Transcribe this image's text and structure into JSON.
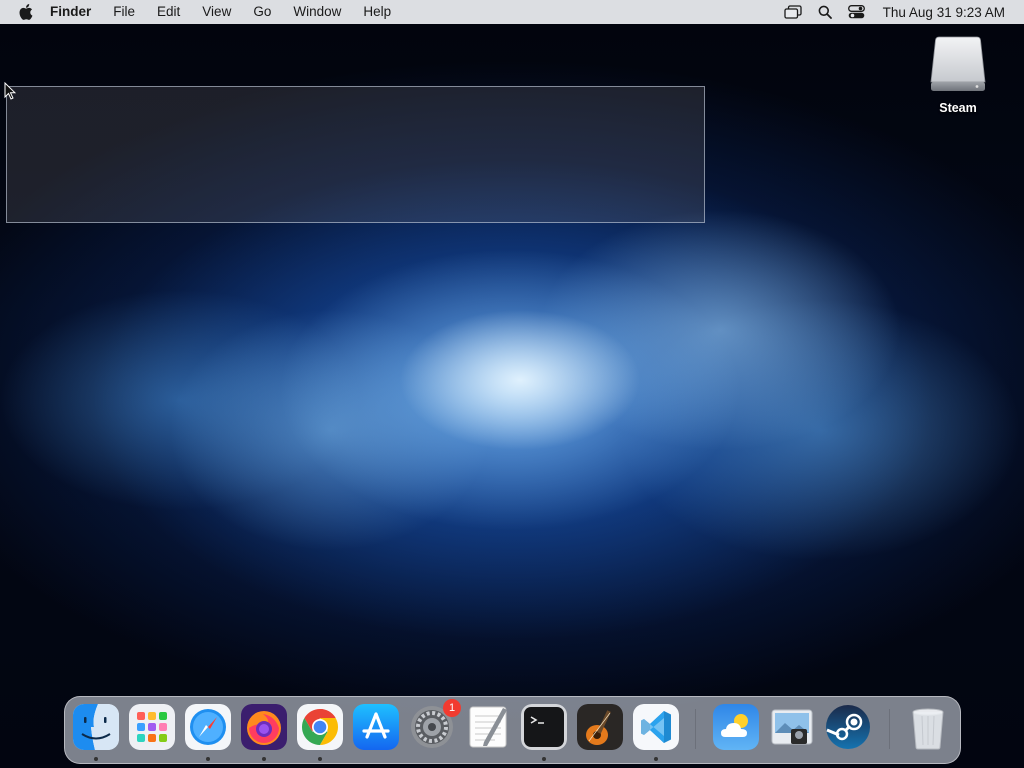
{
  "menubar": {
    "app_name": "Finder",
    "menus": [
      "File",
      "Edit",
      "View",
      "Go",
      "Window",
      "Help"
    ],
    "clock": "Thu Aug 31  9:23 AM",
    "status_icons": [
      "screen-mirroring-icon",
      "spotlight-search-icon",
      "control-center-icon"
    ]
  },
  "desktop": {
    "icons": [
      {
        "label": "Steam",
        "icon": "external-drive-icon"
      }
    ]
  },
  "dock": {
    "apps": [
      {
        "name": "Finder",
        "icon": "finder-icon",
        "running": true
      },
      {
        "name": "Launchpad",
        "icon": "launchpad-icon",
        "running": false
      },
      {
        "name": "Safari",
        "icon": "safari-icon",
        "running": true
      },
      {
        "name": "Firefox",
        "icon": "firefox-icon",
        "running": true
      },
      {
        "name": "Google Chrome",
        "icon": "chrome-icon",
        "running": true
      },
      {
        "name": "App Store",
        "icon": "app-store-icon",
        "running": false
      },
      {
        "name": "System Preferences",
        "icon": "system-preferences-icon",
        "running": false,
        "badge": "1"
      },
      {
        "name": "TextEdit",
        "icon": "textedit-icon",
        "running": false
      },
      {
        "name": "Terminal",
        "icon": "terminal-icon",
        "running": true
      },
      {
        "name": "GarageBand",
        "icon": "garageband-icon",
        "running": false
      },
      {
        "name": "Visual Studio Code",
        "icon": "vscode-icon",
        "running": true
      },
      {
        "name": "Weather",
        "icon": "weather-icon",
        "running": false
      },
      {
        "name": "Preview",
        "icon": "preview-icon",
        "running": false
      },
      {
        "name": "Steam",
        "icon": "steam-icon",
        "running": false
      },
      {
        "name": "Trash",
        "icon": "trash-icon",
        "running": false
      }
    ]
  },
  "colors": {
    "menubar_bg": "#e8eaee",
    "badge": "#f23b30",
    "selection_border": "#c8d2e1"
  }
}
